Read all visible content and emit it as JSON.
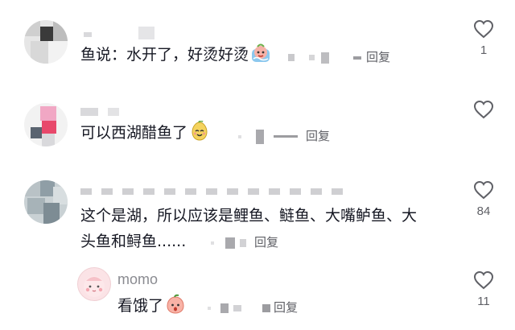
{
  "comments": [
    {
      "text": "鱼说：水开了，好烫好烫",
      "reply_label": "回复",
      "likes": "1"
    },
    {
      "text": "可以西湖醋鱼了",
      "reply_label": "回复",
      "likes": ""
    },
    {
      "text_line1": "这个是湖，所以应该是鲤鱼、鲢鱼、大嘴鲈鱼、大",
      "text_line2": "头鱼和鲟鱼......",
      "reply_label": "回复",
      "likes": "84"
    },
    {
      "username": "momo",
      "text": "看饿了",
      "reply_label": "回复",
      "likes": "11"
    }
  ],
  "icons": {
    "like": "heart-outline-icon"
  }
}
